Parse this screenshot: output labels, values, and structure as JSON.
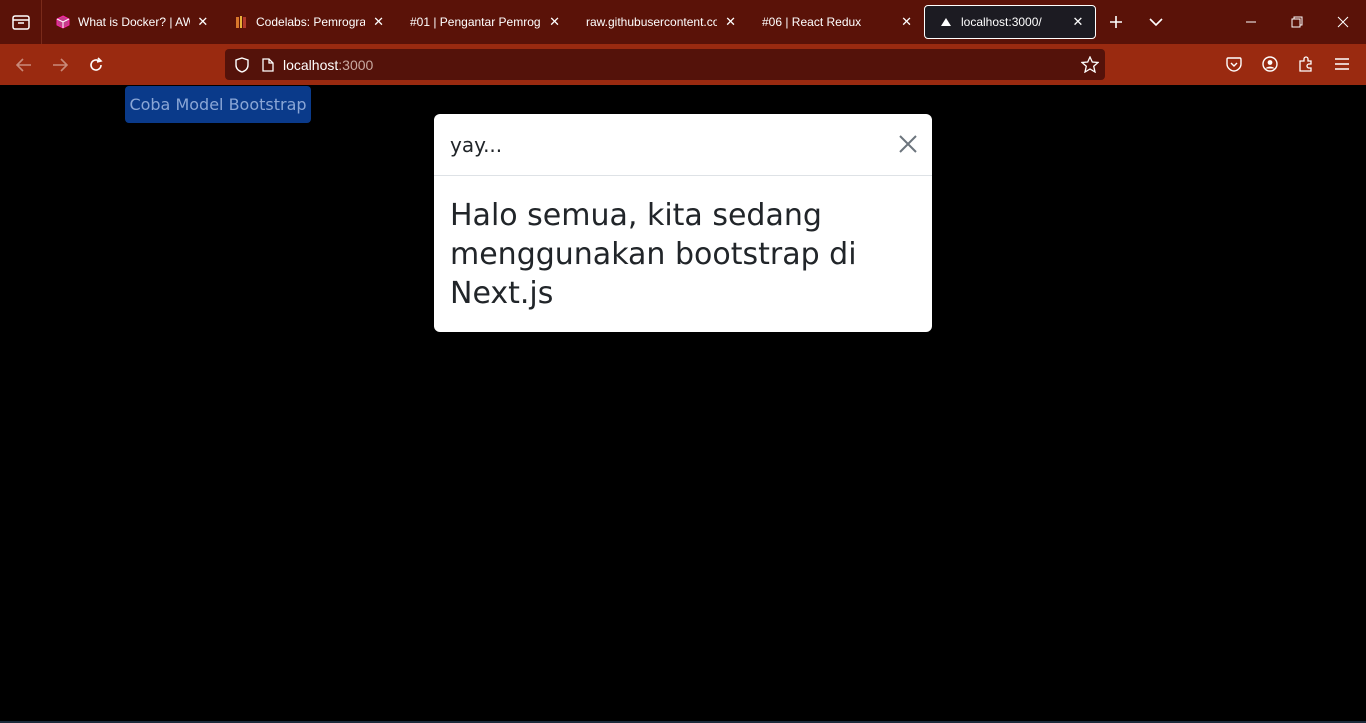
{
  "tabs": [
    {
      "title": "What is Docker? | AWS",
      "favicon": "aws-cube-icon"
    },
    {
      "title": "Codelabs: Pemrogram",
      "favicon": "codelabs-icon"
    },
    {
      "title": "#01 | Pengantar Pemrogra",
      "favicon": ""
    },
    {
      "title": "raw.githubusercontent.cor",
      "favicon": ""
    },
    {
      "title": "#06 | React Redux",
      "favicon": ""
    },
    {
      "title": "localhost:3000/",
      "favicon": "nextjs-triangle-icon",
      "active": true
    }
  ],
  "address": {
    "host": "localhost",
    "port": ":3000"
  },
  "page": {
    "button_label": "Coba Model Bootstrap",
    "modal": {
      "title": "yay...",
      "body": "Halo semua, kita sedang menggunakan bootstrap di Next.js"
    }
  },
  "colors": {
    "tabbar": "#5a1208",
    "navbar": "#9a2a10",
    "urlbar": "#54120a",
    "button": "#0a3a8a"
  }
}
